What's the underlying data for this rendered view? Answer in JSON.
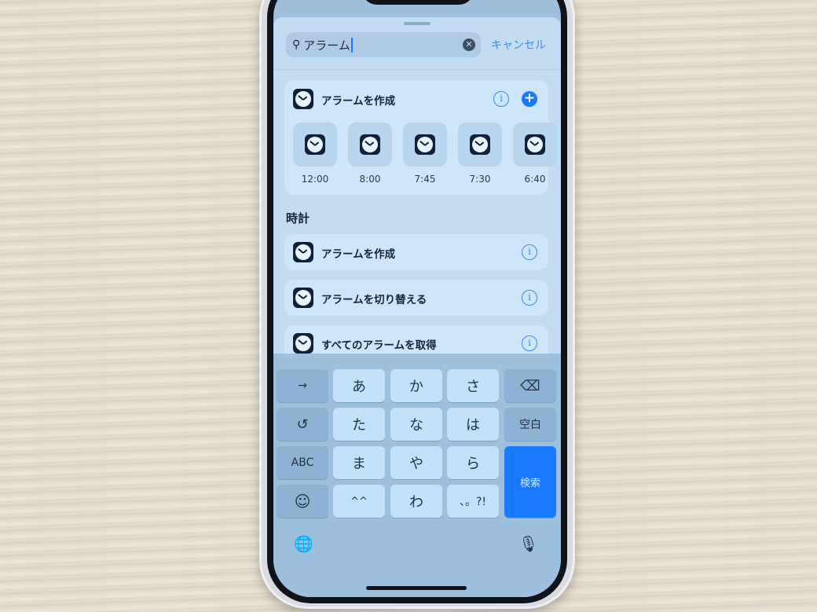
{
  "search": {
    "value": "アラーム",
    "cancel_label": "キャンセル"
  },
  "top_card": {
    "title": "アラームを作成",
    "presets": [
      "12:00",
      "8:00",
      "7:45",
      "7:30",
      "6:40"
    ]
  },
  "section_title": "時計",
  "actions": [
    {
      "title": "アラームを作成"
    },
    {
      "title": "アラームを切り替える"
    },
    {
      "title": "すべてのアラームを取得"
    }
  ],
  "keyboard": {
    "row1": [
      "→",
      "あ",
      "か",
      "さ",
      "⌫"
    ],
    "row2": [
      "↺",
      "た",
      "な",
      "は",
      "空白"
    ],
    "row3": [
      "ABC",
      "ま",
      "や",
      "ら"
    ],
    "row4": [
      "☺",
      "^^",
      "わ",
      "、。?!"
    ],
    "search_key": "検索",
    "globe": "🌐",
    "mic": "🎙"
  },
  "colors": {
    "accent": "#1a7aff"
  }
}
